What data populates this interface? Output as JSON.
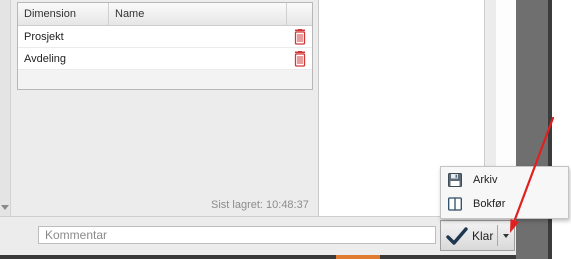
{
  "grid": {
    "columns": [
      "Dimension",
      "Name",
      ""
    ],
    "rows": [
      {
        "dimension": "Prosjekt",
        "name": "",
        "action_icon": "trash-icon"
      },
      {
        "dimension": "Avdeling",
        "name": "",
        "action_icon": "trash-icon"
      }
    ]
  },
  "status": {
    "saved_text": "Sist lagret: 10:48:37"
  },
  "footer": {
    "comment_placeholder": "Kommentar",
    "comment_value": "",
    "klar_label": "Klar",
    "klar_icon": "checkmark-icon",
    "dropdown_icon": "caret-down-icon"
  },
  "menu": {
    "items": [
      {
        "label": "Arkiv",
        "icon": "floppy-disk-icon"
      },
      {
        "label": "Bokfør",
        "icon": "book-icon"
      }
    ]
  },
  "colors": {
    "trash": "#d03838",
    "arrow": "#e02020",
    "checkmark": "#1f3550"
  }
}
